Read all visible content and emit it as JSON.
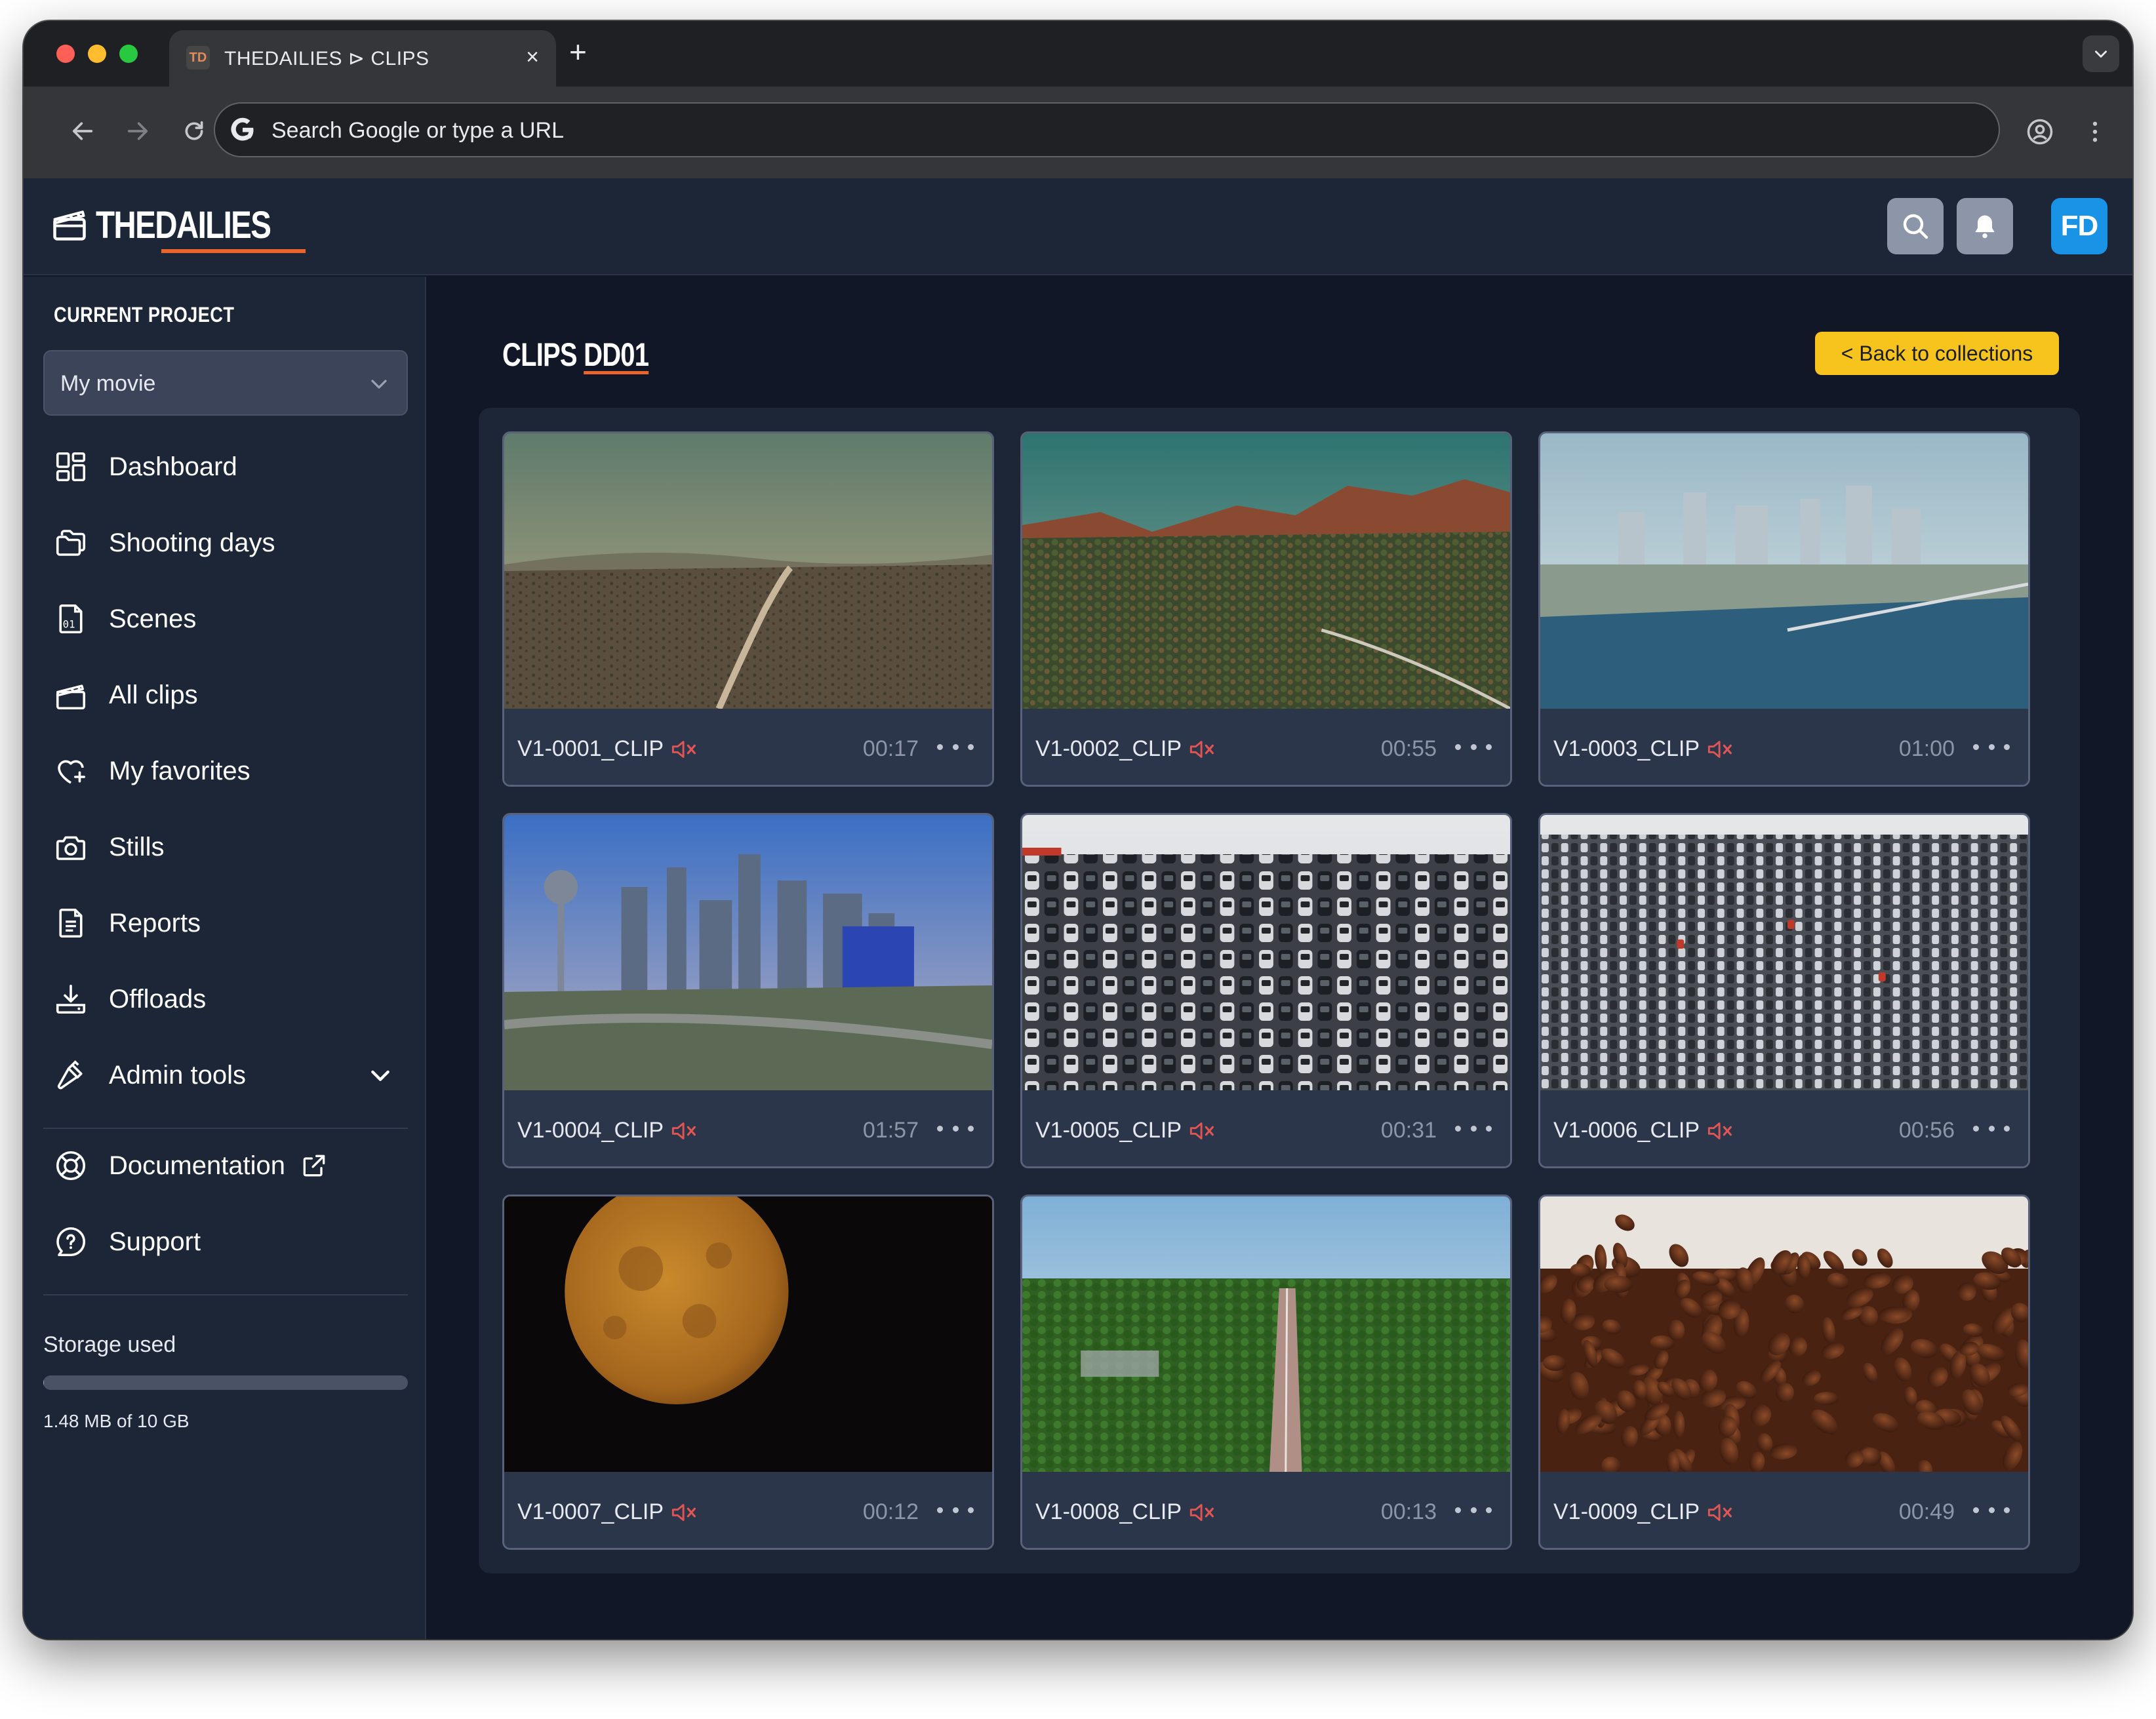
{
  "browser": {
    "tab_favicon": "TD",
    "tab_title": "THEDAILIES ⊳ CLIPS",
    "tab_close": "×",
    "new_tab": "+",
    "omnibox_placeholder": "Search Google or type a URL"
  },
  "header": {
    "logo_text": "THEDAILIES",
    "avatar_initials": "FD",
    "accent_color": "#e8652b",
    "avatar_color": "#1893e6"
  },
  "sidebar": {
    "project_label": "CURRENT PROJECT",
    "project_value": "My movie",
    "items": [
      {
        "label": "Dashboard",
        "icon": "dashboard-icon"
      },
      {
        "label": "Shooting days",
        "icon": "folders-icon"
      },
      {
        "label": "Scenes",
        "icon": "scene-file-icon"
      },
      {
        "label": "All clips",
        "icon": "clapperboard-icon"
      },
      {
        "label": "My favorites",
        "icon": "heart-plus-icon"
      },
      {
        "label": "Stills",
        "icon": "camera-icon"
      },
      {
        "label": "Reports",
        "icon": "report-icon"
      },
      {
        "label": "Offloads",
        "icon": "download-tray-icon"
      },
      {
        "label": "Admin tools",
        "icon": "hammer-icon"
      }
    ],
    "footer_items": [
      {
        "label": "Documentation",
        "icon": "lifebuoy-icon"
      },
      {
        "label": "Support",
        "icon": "chat-question-icon"
      }
    ],
    "storage": {
      "label": "Storage used",
      "text": "1.48 MB of 10 GB",
      "fraction": 0.00015
    }
  },
  "main": {
    "title_prefix": "CLIPS",
    "title_code": "DD01",
    "back_button": "< Back to collections",
    "back_button_color": "#f7c31d",
    "clips": [
      {
        "name": "V1-0001_CLIP",
        "duration": "00:17",
        "muted": true,
        "thumbnail": "desert-road-aerial"
      },
      {
        "name": "V1-0002_CLIP",
        "duration": "00:55",
        "muted": true,
        "thumbnail": "red-rock-mesa-aerial"
      },
      {
        "name": "V1-0003_CLIP",
        "duration": "01:00",
        "muted": true,
        "thumbnail": "waterfront-city-aerial"
      },
      {
        "name": "V1-0004_CLIP",
        "duration": "01:57",
        "muted": true,
        "thumbnail": "city-skyline-tower"
      },
      {
        "name": "V1-0005_CLIP",
        "duration": "00:31",
        "muted": true,
        "thumbnail": "car-parking-lot"
      },
      {
        "name": "V1-0006_CLIP",
        "duration": "00:56",
        "muted": true,
        "thumbnail": "car-lot-rows"
      },
      {
        "name": "V1-0007_CLIP",
        "duration": "00:12",
        "muted": true,
        "thumbnail": "full-moon"
      },
      {
        "name": "V1-0008_CLIP",
        "duration": "00:13",
        "muted": true,
        "thumbnail": "forest-highway-aerial"
      },
      {
        "name": "V1-0009_CLIP",
        "duration": "00:49",
        "muted": true,
        "thumbnail": "coffee-beans"
      }
    ]
  }
}
